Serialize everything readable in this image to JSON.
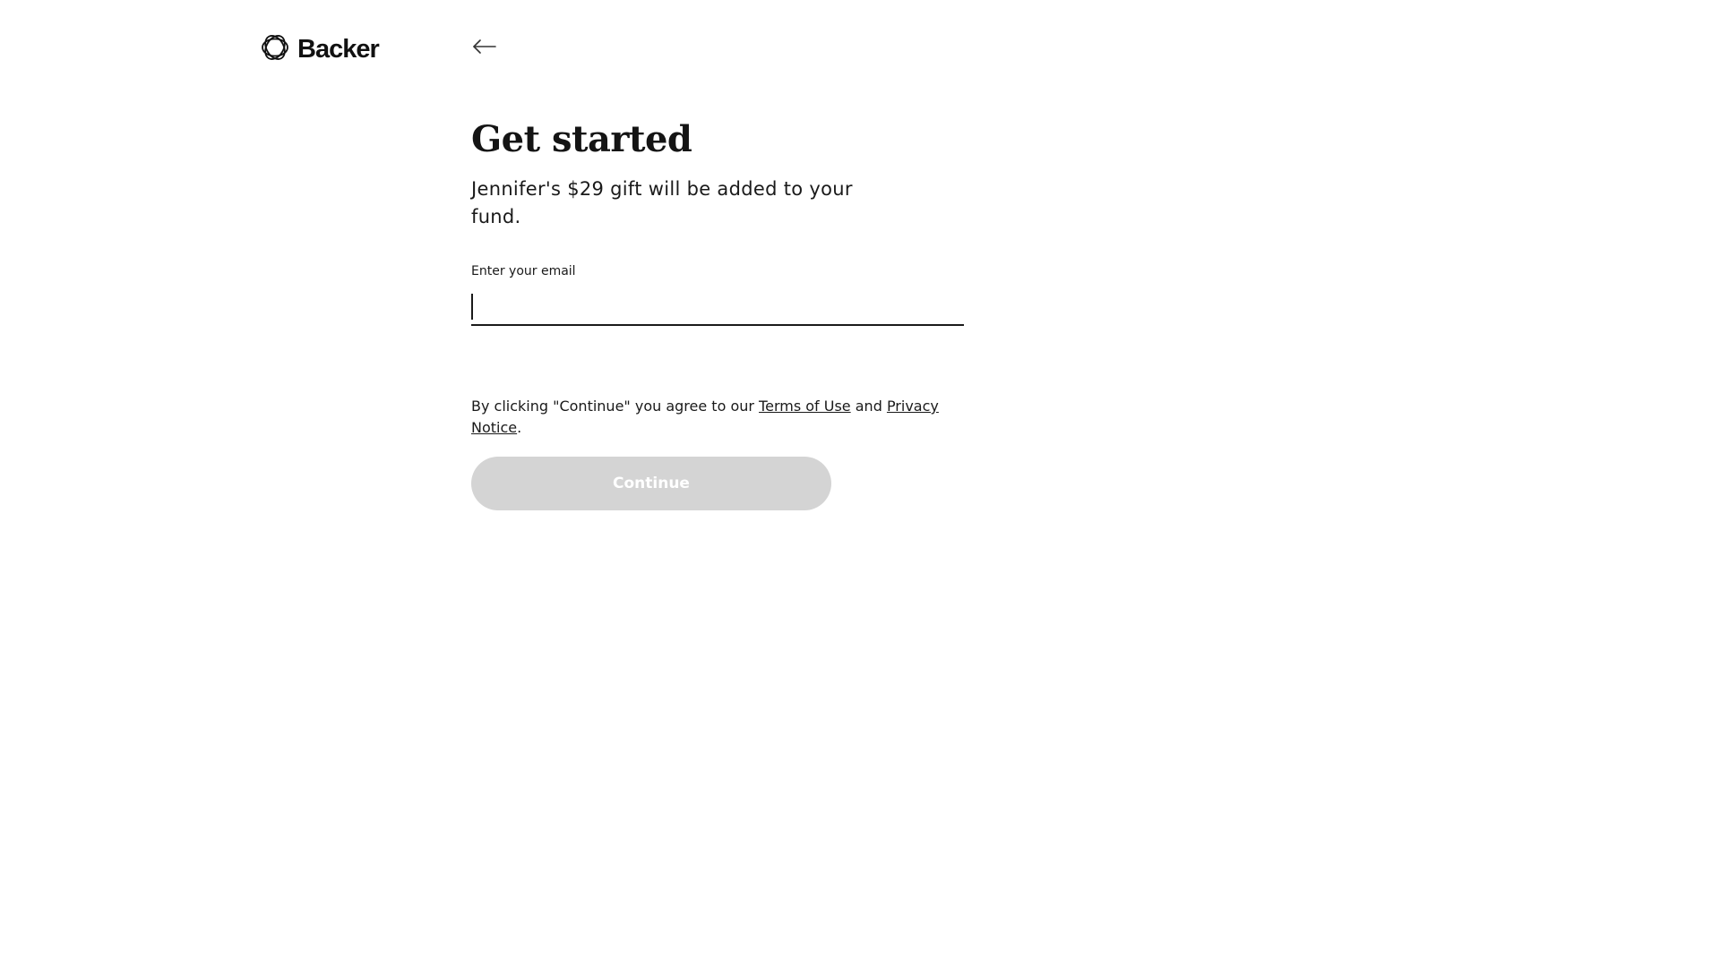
{
  "brand": {
    "name": "Backer",
    "logo_icon": "backer-rosette-icon"
  },
  "nav": {
    "back_icon": "arrow-left-icon"
  },
  "signup": {
    "title": "Get started",
    "subtitle": "Jennifer's $29 gift will be added to your fund.",
    "email_label": "Enter your email",
    "email_value": "",
    "legal_prefix": "By clicking \"Continue\" you agree to our ",
    "terms_link": "Terms of Use",
    "legal_and": " and ",
    "privacy_link": "Privacy Notice",
    "legal_suffix": ".",
    "continue_label": "Continue",
    "continue_disabled": true
  },
  "colors": {
    "text": "#1a1a1a",
    "button_disabled_bg": "#d4d4d4",
    "button_disabled_text": "#ffffff",
    "background": "#ffffff"
  }
}
